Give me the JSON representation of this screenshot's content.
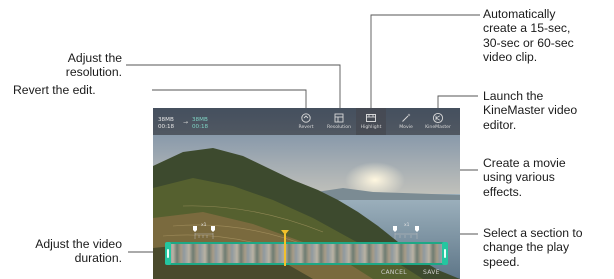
{
  "callouts": {
    "resolution": [
      "Adjust the",
      "resolution."
    ],
    "revert": [
      "Revert the edit."
    ],
    "duration": [
      "Adjust the video",
      "duration."
    ],
    "auto_clip": [
      "Automatically",
      "create a 15-sec,",
      "30-sec or 60-sec",
      "video clip."
    ],
    "kinemaster": [
      "Launch the",
      "KineMaster video",
      "editor."
    ],
    "movie": [
      "Create a movie",
      "using various",
      "effects."
    ],
    "play_speed": [
      "Select a section to",
      "change the play",
      "speed."
    ]
  },
  "screen": {
    "size_left_value": "38MB",
    "size_left_time": "00:18",
    "size_right_value": "38MB",
    "size_right_time": "00:18",
    "tools": [
      {
        "label": "Revert",
        "icon": "revert-icon"
      },
      {
        "label": "Resolution",
        "icon": "resolution-icon"
      },
      {
        "label": "Highlight",
        "icon": "highlight-clip-icon"
      },
      {
        "label": "Movie",
        "icon": "magic-wand-icon"
      },
      {
        "label": "KineMaster",
        "icon": "kinemaster-icon"
      }
    ],
    "speed_labels": [
      "x1",
      "x1"
    ],
    "cancel_label": "CANCEL",
    "save_label": "SAVE"
  },
  "colors": {
    "timeline_accent": "#1ea886",
    "playhead": "#f2c12c",
    "leader_line": "#555555"
  }
}
